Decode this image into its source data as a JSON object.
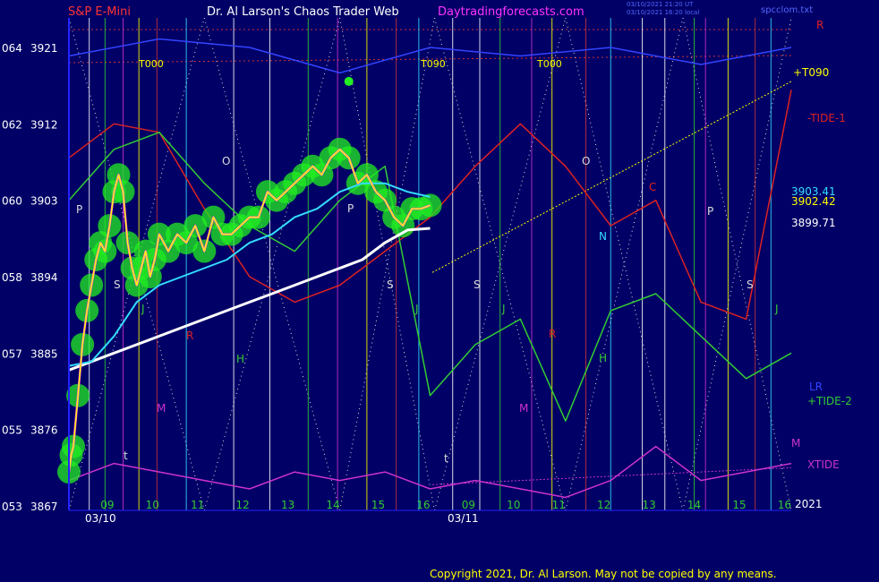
{
  "header": {
    "instrument": "S&P E-Mini",
    "site_title": "Dr. Al Larson's Chaos Trader Web",
    "site_url": "Daytradingforecasts.com",
    "timestamp_1": "03/10/2021 21:20 UT",
    "timestamp_2": "03/10/2021 16:20 local",
    "filename": "spcclom.txt"
  },
  "footer": {
    "copyright": "Copyright 2021, Dr. Al Larson. May not be copied by any means."
  },
  "colors": {
    "background": "#000066",
    "axis": "#2222ff",
    "price_yellow": "#ffff00",
    "price_magenta": "#ff33ff",
    "glow_green": "#22ee22",
    "avg_cyan": "#33ddff",
    "avg_white": "#ffffff",
    "tide_red": "#dd2222",
    "tide_green": "#33cc33",
    "xtide_magenta": "#cc33cc",
    "channel_blue": "#3344ff",
    "grid_red": "#cc3333"
  },
  "chart_data": {
    "type": "line",
    "y_axis_labels": [
      {
        "code": "064",
        "price": "3921"
      },
      {
        "code": "062",
        "price": "3912"
      },
      {
        "code": "060",
        "price": "3903"
      },
      {
        "code": "058",
        "price": "3894"
      },
      {
        "code": "057",
        "price": "3885"
      },
      {
        "code": "055",
        "price": "3876"
      },
      {
        "code": "053",
        "price": "3867"
      }
    ],
    "ylim": [
      3867,
      3921
    ],
    "x_hour_labels": [
      "09",
      "10",
      "11",
      "12",
      "13",
      "14",
      "15",
      "16",
      "09",
      "10",
      "11",
      "12",
      "13",
      "14",
      "15",
      "16"
    ],
    "x_date_labels": [
      "03/10",
      "03/11"
    ],
    "year_label": "2021",
    "right_labels": [
      {
        "text": "R",
        "color": "#dd2222"
      },
      {
        "text": "+T090",
        "color": "#ffff00"
      },
      {
        "text": "-TIDE-1",
        "color": "#dd2222"
      },
      {
        "text": "3903.41",
        "color": "#33ddff"
      },
      {
        "text": "3902.42",
        "color": "#ffff00"
      },
      {
        "text": "3899.71",
        "color": "#ffffff"
      },
      {
        "text": "LR",
        "color": "#3344ff"
      },
      {
        "text": "+TIDE-2",
        "color": "#33cc33"
      },
      {
        "text": "M",
        "color": "#cc33cc"
      },
      {
        "text": "XTIDE",
        "color": "#cc33cc"
      }
    ],
    "top_labels": [
      "T000",
      "T090",
      "T000"
    ],
    "field_letters": [
      {
        "text": "P",
        "color": "#dddddd"
      },
      {
        "text": "S",
        "color": "#dddddd"
      },
      {
        "text": "J",
        "color": "#33cc33"
      },
      {
        "text": "R",
        "color": "#dd2222"
      },
      {
        "text": "H",
        "color": "#33cc33"
      },
      {
        "text": "M",
        "color": "#cc33cc"
      },
      {
        "text": "t",
        "color": "#dddddd"
      },
      {
        "text": "O",
        "color": "#dddddd"
      },
      {
        "text": "P",
        "color": "#dddddd"
      },
      {
        "text": "S",
        "color": "#dddddd"
      },
      {
        "text": "J",
        "color": "#33cc33"
      },
      {
        "text": "S",
        "color": "#dddddd"
      },
      {
        "text": "J",
        "color": "#33cc33"
      },
      {
        "text": "R",
        "color": "#dd2222"
      },
      {
        "text": "M",
        "color": "#cc33cc"
      },
      {
        "text": "t",
        "color": "#dddddd"
      },
      {
        "text": "O",
        "color": "#dddddd"
      },
      {
        "text": "N",
        "color": "#33ddff"
      },
      {
        "text": "H",
        "color": "#33cc33"
      },
      {
        "text": "C",
        "color": "#dd2222"
      },
      {
        "text": "P",
        "color": "#dddddd"
      },
      {
        "text": "S",
        "color": "#dddddd"
      },
      {
        "text": "J",
        "color": "#33cc33"
      }
    ],
    "series": [
      {
        "name": "price",
        "x": [
          0,
          0.05,
          0.1,
          0.2,
          0.3,
          0.4,
          0.5,
          0.6,
          0.7,
          0.8,
          0.9,
          1.0,
          1.1,
          1.2,
          1.3,
          1.4,
          1.5,
          1.6,
          1.7,
          1.8,
          1.9,
          2.0,
          2.2,
          2.4,
          2.6,
          2.8,
          3.0,
          3.2,
          3.4,
          3.6,
          3.8,
          4.0,
          4.2,
          4.4,
          4.6,
          4.8,
          5.0,
          5.2,
          5.4,
          5.6,
          5.8,
          6.0,
          6.2,
          6.4,
          6.6,
          6.8,
          7.0,
          7.2,
          7.4,
          7.6,
          7.8,
          8.0
        ],
        "y": [
          3871,
          3873,
          3874,
          3880,
          3886,
          3890,
          3893,
          3896,
          3898,
          3897,
          3900,
          3904,
          3906,
          3904,
          3898,
          3895,
          3893,
          3895,
          3897,
          3894,
          3896,
          3899,
          3897,
          3899,
          3898,
          3900,
          3897,
          3901,
          3899,
          3899,
          3900,
          3901,
          3901,
          3904,
          3903,
          3904,
          3905,
          3906,
          3907,
          3906,
          3908,
          3909,
          3908,
          3905,
          3906,
          3904,
          3903,
          3901,
          3900,
          3902,
          3902,
          3902.4
        ]
      },
      {
        "name": "",
        "x": [
          0,
          0.5,
          1,
          1.5,
          2,
          2.5,
          3,
          3.5,
          4,
          4.5,
          5,
          5.5,
          6,
          6.5,
          7,
          7.5,
          8
        ],
        "y": [
          3883.5,
          3884,
          3887,
          3891,
          3893,
          3894,
          3895,
          3896,
          3898,
          3899,
          3901,
          3902,
          3904,
          3905,
          3905,
          3904,
          3903.4
        ]
      },
      {
        "name": "",
        "x": [
          0,
          0.5,
          1,
          1.5,
          2,
          2.5,
          3,
          3.5,
          4,
          4.5,
          5,
          5.5,
          6,
          6.5,
          7,
          7.5,
          8
        ],
        "y": [
          3883,
          3884,
          3885,
          3886,
          3887,
          3888,
          3889,
          3890,
          3891,
          3892,
          3893,
          3894,
          3895,
          3896,
          3898,
          3899.5,
          3899.7
        ]
      },
      {
        "name": "-TIDE-1",
        "x": [
          0,
          1,
          2,
          3,
          4,
          5,
          6,
          7,
          8,
          9,
          10,
          11,
          12,
          13,
          14,
          15,
          16
        ],
        "y": [
          3908,
          3912,
          3911,
          3902,
          3894,
          3891,
          3893,
          3897,
          3901,
          3907,
          3912,
          3907,
          3900,
          3903,
          3891,
          3889,
          3916
        ]
      },
      {
        "name": "+TIDE-2",
        "x": [
          0,
          1,
          2,
          3,
          4,
          5,
          6,
          7,
          8,
          9,
          10,
          11,
          12,
          13,
          14,
          15,
          16
        ],
        "y": [
          3903,
          3909,
          3911,
          3905,
          3900,
          3897,
          3903,
          3907,
          3880,
          3886,
          3889,
          3877,
          3890,
          3892,
          3887,
          3882,
          3885
        ]
      },
      {
        "name": "XTIDE",
        "x": [
          0,
          1,
          2,
          3,
          4,
          5,
          6,
          7,
          8,
          9,
          10,
          11,
          12,
          13,
          14,
          15,
          16
        ],
        "y": [
          3870,
          3872,
          3871,
          3870,
          3869,
          3871,
          3870,
          3871,
          3869,
          3870,
          3869,
          3868,
          3870,
          3874,
          3870,
          3871,
          3872
        ]
      },
      {
        "name": "LR",
        "x": [
          0,
          2,
          4,
          6,
          8,
          10,
          12,
          14,
          16
        ],
        "y": [
          3920,
          3922,
          3921,
          3918,
          3921,
          3920,
          3921,
          3919,
          3921
        ]
      }
    ]
  }
}
